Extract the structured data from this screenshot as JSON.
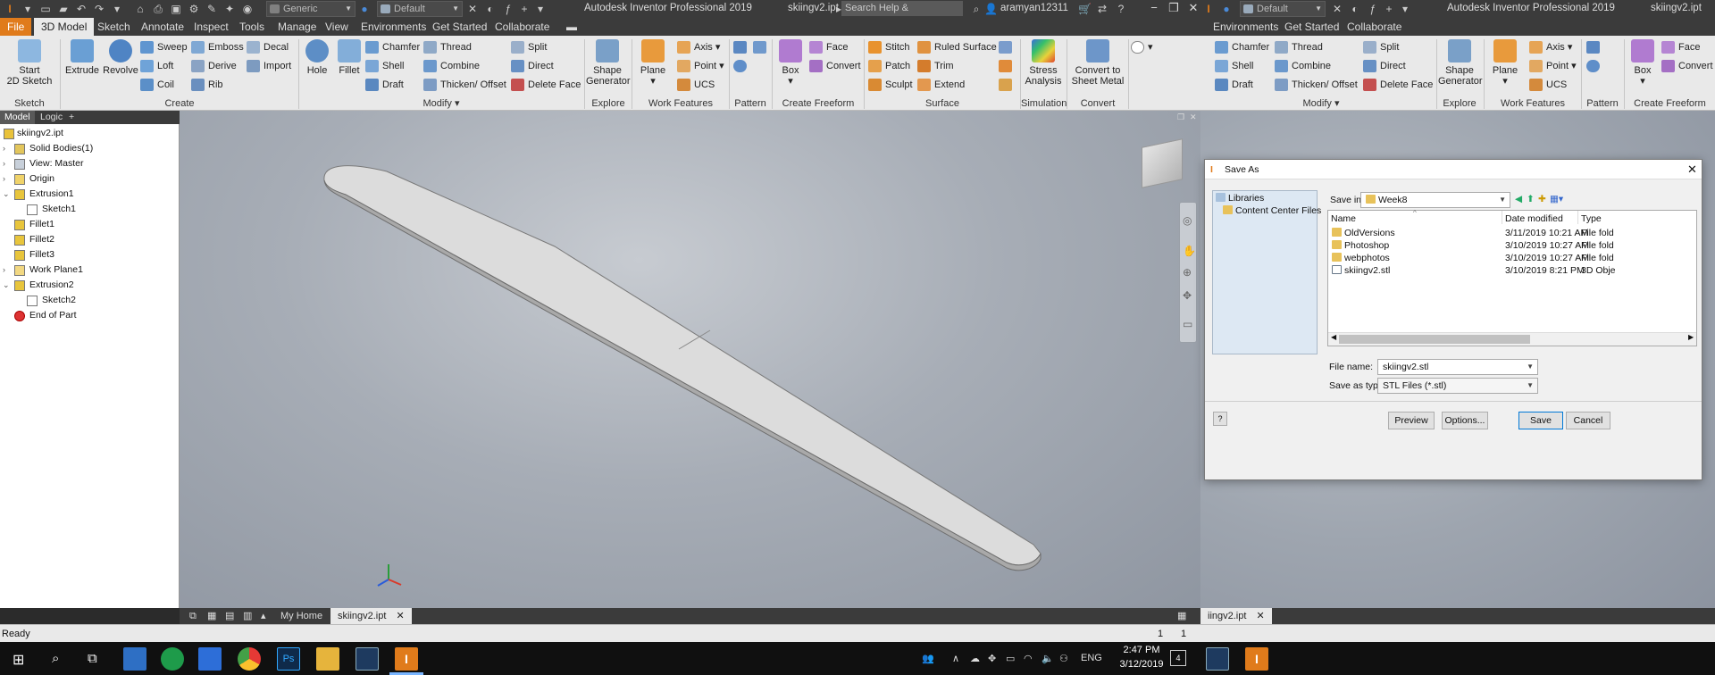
{
  "titlebar": {
    "app_title": "Autodesk Inventor Professional 2019",
    "file_name": "skiingv2.ipt",
    "material_combo": "Generic",
    "appearance_combo": "Default",
    "appearance_combo_right": "Default",
    "search_placeholder": "Search Help & Commands...",
    "user": "aramyan12311"
  },
  "tabs": [
    "File",
    "3D Model",
    "Sketch",
    "Annotate",
    "Inspect",
    "Tools",
    "Manage",
    "View",
    "Environments",
    "Get Started",
    "Collaborate"
  ],
  "tabs_right": [
    "Environments",
    "Get Started",
    "Collaborate"
  ],
  "ribbon": {
    "sketch": {
      "start_line1": "Start",
      "start_line2": "2D Sketch",
      "label": "Sketch"
    },
    "create": {
      "extrude": "Extrude",
      "revolve": "Revolve",
      "sweep": "Sweep",
      "loft": "Loft",
      "coil": "Coil",
      "emboss": "Emboss",
      "derive": "Derive",
      "rib": "Rib",
      "decal": "Decal",
      "import": "Import",
      "label": "Create"
    },
    "modify": {
      "hole": "Hole",
      "fillet": "Fillet",
      "chamfer": "Chamfer",
      "shell": "Shell",
      "draft": "Draft",
      "thread": "Thread",
      "combine": "Combine",
      "thicken": "Thicken/ Offset",
      "split": "Split",
      "direct": "Direct",
      "delete_face": "Delete Face",
      "label": "Modify"
    },
    "explore": {
      "shape_line1": "Shape",
      "shape_line2": "Generator",
      "label": "Explore"
    },
    "work": {
      "plane": "Plane",
      "axis": "Axis",
      "point": "Point",
      "ucs": "UCS",
      "label": "Work Features"
    },
    "pattern": {
      "label": "Pattern"
    },
    "freeform": {
      "box": "Box",
      "face": "Face",
      "convert": "Convert",
      "label": "Create Freeform"
    },
    "surface": {
      "stitch": "Stitch",
      "patch": "Patch",
      "sculpt": "Sculpt",
      "ruled": "Ruled Surface",
      "trim": "Trim",
      "extend": "Extend",
      "label": "Surface"
    },
    "simulation": {
      "stress_line1": "Stress",
      "stress_line2": "Analysis",
      "label": "Simulation"
    },
    "convert": {
      "line1": "Convert to",
      "line2": "Sheet Metal",
      "label": "Convert"
    }
  },
  "browser": {
    "tab_model": "Model",
    "tab_logic": "Logic",
    "items": [
      "skiingv2.ipt",
      "Solid Bodies(1)",
      "View: Master",
      "Origin",
      "Extrusion1",
      "Sketch1",
      "Fillet1",
      "Fillet2",
      "Fillet3",
      "Work Plane1",
      "Extrusion2",
      "Sketch2",
      "End of Part"
    ]
  },
  "doc_tabs": {
    "home": "My Home",
    "file": "skiingv2.ipt",
    "file_right": "iingv2.ipt"
  },
  "status": {
    "ready": "Ready",
    "count1": "1",
    "count2": "1"
  },
  "taskbar": {
    "time": "2:47 PM",
    "date": "3/12/2019",
    "lang": "ENG",
    "notif_count": "4"
  },
  "dialog": {
    "title": "Save As",
    "places": [
      "Libraries",
      "Content Center Files"
    ],
    "save_in_label": "Save in:",
    "save_in_value": "Week8",
    "columns": [
      "Name",
      "Date modified",
      "Type"
    ],
    "files": [
      {
        "name": "OldVersions",
        "date": "3/11/2019 10:21 AM",
        "type": "File fold"
      },
      {
        "name": "Photoshop",
        "date": "3/10/2019 10:27 AM",
        "type": "File fold"
      },
      {
        "name": "webphotos",
        "date": "3/10/2019 10:27 AM",
        "type": "File fold"
      },
      {
        "name": "skiingv2.stl",
        "date": "3/10/2019 8:21 PM",
        "type": "3D Obje"
      }
    ],
    "file_name_label": "File name:",
    "file_name_value": "skiingv2.stl",
    "save_type_label": "Save as type:",
    "save_type_value": "STL Files (*.stl)",
    "preview": "Preview",
    "options": "Options...",
    "save": "Save",
    "cancel": "Cancel"
  },
  "colors": {
    "file_tab": "#e07b1b",
    "ribbon_bg": "#e9e9e9",
    "dark_chrome": "#3b3b3b",
    "taskbar": "#101010",
    "dialog_bg": "#f0f0f0"
  }
}
